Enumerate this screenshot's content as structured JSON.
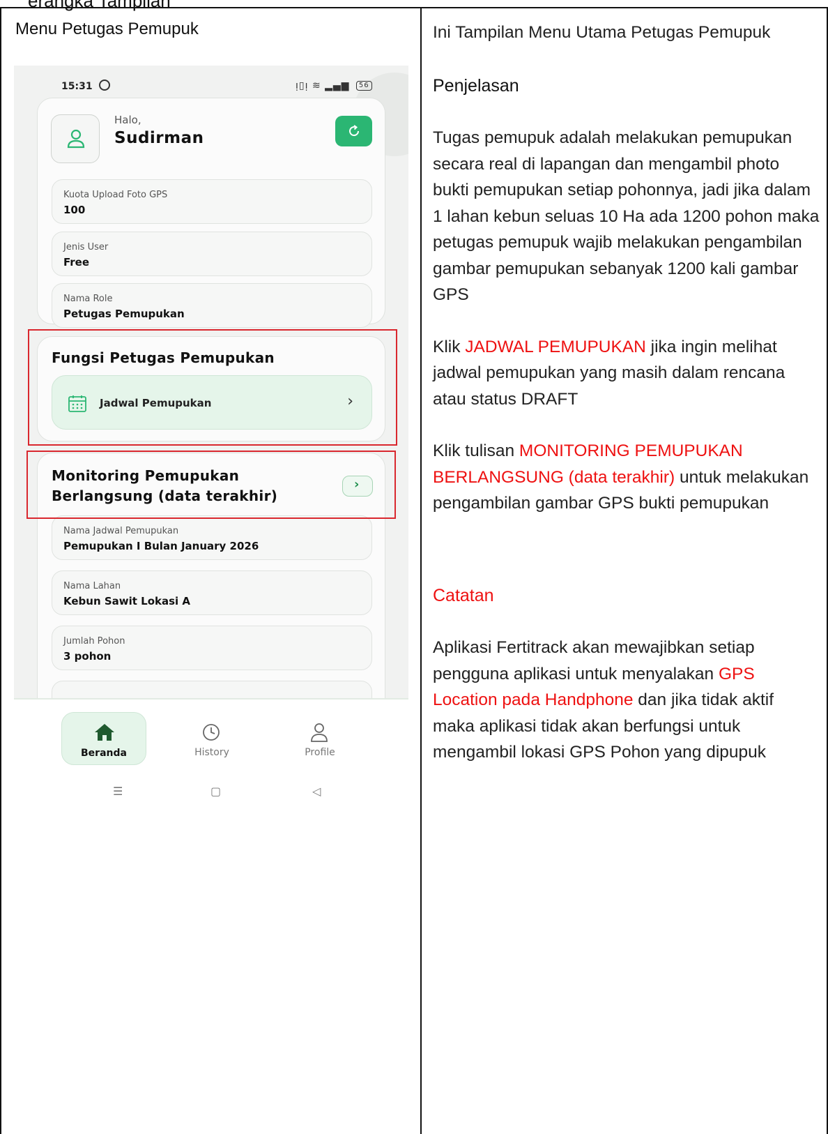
{
  "doc": {
    "top_fragment": "erangka Tampilan",
    "left_title": "Menu Petugas Pemupuk",
    "right": {
      "intro": "Ini Tampilan Menu Utama Petugas Pemupuk",
      "penjelasan_heading": "Penjelasan",
      "paragraph1": "Tugas pemupuk adalah melakukan pemupukan secara real di lapangan dan mengambil photo bukti pemupukan setiap pohonnya, jadi jika dalam 1 lahan kebun seluas 10 Ha ada 1200 pohon maka petugas pemupuk wajib melakukan pengambilan gambar pemupukan sebanyak 1200 kali gambar GPS",
      "p2_pre": "Klik ",
      "p2_highlight": "JADWAL PEMUPUKAN",
      "p2_post": " jika ingin melihat jadwal pemupukan yang masih dalam rencana atau status DRAFT",
      "p3_pre": "Klik tulisan ",
      "p3_highlight": "MONITORING PEMUPUKAN BERLANGSUNG (data terakhir)",
      "p3_post": " untuk melakukan pengambilan gambar GPS bukti pemupukan",
      "catatan_heading": "Catatan",
      "p4_pre": "Aplikasi Fertitrack akan mewajibkan setiap pengguna aplikasi untuk menyalakan ",
      "p4_highlight": "GPS Location pada Handphone",
      "p4_post": " dan jika tidak aktif maka aplikasi tidak akan berfungsi untuk mengambil lokasi GPS Pohon yang dipupuk"
    }
  },
  "phone": {
    "status_time": "15:31",
    "battery": "56",
    "greeting": "Halo,",
    "user_name": "Sudirman",
    "info": [
      {
        "label": "Kuota Upload Foto GPS",
        "value": "100"
      },
      {
        "label": "Jenis User",
        "value": "Free"
      },
      {
        "label": "Nama Role",
        "value": "Petugas Pemupukan"
      }
    ],
    "fungsi_heading": "Fungsi Petugas Pemupukan",
    "jadwal_label": "Jadwal Pemupukan",
    "monitoring_title_line1": "Monitoring Pemupukan",
    "monitoring_title_line2": "Berlangsung (data terakhir)",
    "monitor_info": [
      {
        "label": "Nama Jadwal Pemupukan",
        "value": "Pemupukan I Bulan January 2026"
      },
      {
        "label": "Nama Lahan",
        "value": "Kebun Sawit Lokasi A"
      },
      {
        "label": "Jumlah Pohon",
        "value": "3 pohon"
      }
    ],
    "nav": [
      {
        "label": "Beranda",
        "icon": "home-icon",
        "active": true
      },
      {
        "label": "History",
        "icon": "clock-icon",
        "active": false
      },
      {
        "label": "Profile",
        "icon": "user-icon",
        "active": false
      }
    ],
    "colors": {
      "accent": "#2bb673",
      "highlight_red": "#ee1111",
      "annotation_box": "#d9272e"
    }
  }
}
